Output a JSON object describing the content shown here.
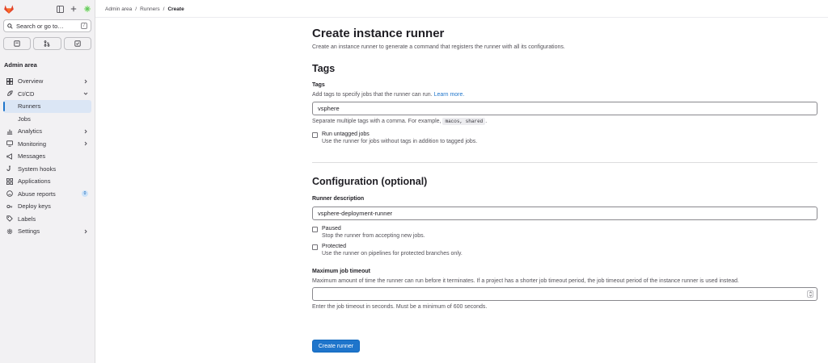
{
  "sidebar": {
    "search_label": "Search or go to…",
    "search_shortcut": "/",
    "section_title": "Admin area",
    "items": [
      {
        "label": "Overview",
        "icon": "overview-icon"
      },
      {
        "label": "CI/CD",
        "icon": "rocket-icon"
      },
      {
        "label": "Runners"
      },
      {
        "label": "Jobs"
      },
      {
        "label": "Analytics",
        "icon": "chart-icon"
      },
      {
        "label": "Monitoring",
        "icon": "monitor-icon"
      },
      {
        "label": "Messages",
        "icon": "megaphone-icon"
      },
      {
        "label": "System hooks",
        "icon": "hook-icon"
      },
      {
        "label": "Applications",
        "icon": "applications-icon"
      },
      {
        "label": "Abuse reports",
        "icon": "slight-frown-icon",
        "badge": "0"
      },
      {
        "label": "Deploy keys",
        "icon": "key-icon"
      },
      {
        "label": "Labels",
        "icon": "label-icon"
      },
      {
        "label": "Settings",
        "icon": "settings-icon"
      }
    ]
  },
  "breadcrumb": [
    "Admin area",
    "/",
    "Runners",
    "/",
    "Create"
  ],
  "page": {
    "title": "Create instance runner",
    "subtitle": "Create an instance runner to generate a command that registers the runner with all its configurations."
  },
  "tags_section": {
    "heading": "Tags",
    "label": "Tags",
    "help_prefix": "Add tags to specify jobs that the runner can run.",
    "help_link": "Learn more.",
    "value": "vsphere",
    "separator_help": "Separate multiple tags with a comma. For example,",
    "separator_example": "macos, shared",
    "separator_suffix": ".",
    "untagged_label": "Run untagged jobs",
    "untagged_help": "Use the runner for jobs without tags in addition to tagged jobs."
  },
  "config_section": {
    "heading": "Configuration (optional)",
    "description_label": "Runner description",
    "description_value": "vsphere-deployment-runner",
    "paused_label": "Paused",
    "paused_help": "Stop the runner from accepting new jobs.",
    "protected_label": "Protected",
    "protected_help": "Use the runner on pipelines for protected branches only.",
    "timeout_label": "Maximum job timeout",
    "timeout_help": "Maximum amount of time the runner can run before it terminates. If a project has a shorter job timeout period, the job timeout period of the instance runner is used instead.",
    "timeout_value": "",
    "timeout_footer": "Enter the job timeout in seconds. Must be a minimum of 600 seconds."
  },
  "actions": {
    "create_label": "Create runner"
  },
  "colors": {
    "accent": "#1f75cb",
    "sidebar_bg": "#f2f1f3",
    "active_bg": "#dbe6f5"
  }
}
